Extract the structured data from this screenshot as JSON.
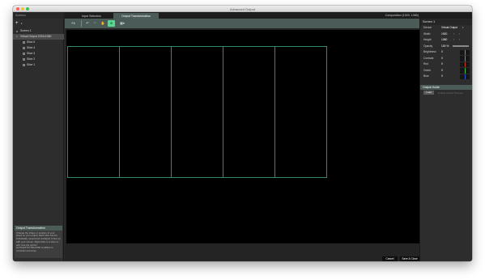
{
  "window": {
    "title": "Advanced Output"
  },
  "tabs": [
    {
      "label": "Input Selection",
      "active": false
    },
    {
      "label": "Output Transformation",
      "active": true
    }
  ],
  "composition_size": "Composition (1920, 1080)",
  "sidebar": {
    "header": "Screens",
    "add_label": "+",
    "items": [
      {
        "label": "Screen 1",
        "level": 0
      },
      {
        "label": "Virtual Output 1920x1080",
        "level": 1
      },
      {
        "label": "Slice 5",
        "level": 2
      },
      {
        "label": "Slice 4",
        "level": 2
      },
      {
        "label": "Slice 3",
        "level": 2
      },
      {
        "label": "Slice 2",
        "level": 2
      },
      {
        "label": "Slice 1",
        "level": 2
      }
    ],
    "help": {
      "title": "Output Transformation",
      "body": "Change the shape or position of your slices on your output. Each slice can be individually moved and reshaped to line up with your screen. Right click on a slice to edit. Use the option/ ALT/SHIFT/CTRL/CMD modifiers to constrain and snap."
    }
  },
  "toolbar": {
    "fit_label": "Fit",
    "undo_icon": "↶",
    "redo_icon": "↷",
    "grab_icon": "✋",
    "transform_icon": "⊕",
    "grid_icon": "▦▾"
  },
  "canvas": {
    "slice_count": 5,
    "background": "#000000",
    "slice_outline_color": "#2f8a6e"
  },
  "footer": {
    "cancel_label": "Cancel",
    "save_label": "Save & Close"
  },
  "properties": {
    "title": "Screen 1",
    "device": {
      "label": "Device",
      "value": "Virtual Output"
    },
    "width": {
      "label": "Width",
      "value": "1920"
    },
    "height": {
      "label": "Height",
      "value": "1080"
    },
    "opacity": {
      "label": "Opacity",
      "value": "100 %",
      "level": 1.0
    },
    "brightness": {
      "label": "Brightness",
      "value": "0"
    },
    "contrast": {
      "label": "Contrast",
      "value": "0"
    },
    "red": {
      "label": "Red",
      "value": "0",
      "color": "#d03a2a"
    },
    "green": {
      "label": "Green",
      "value": "0",
      "color": "#3cc04a"
    },
    "blue": {
      "label": "Blue",
      "value": "0",
      "color": "#2a5ad0"
    },
    "output_guide": {
      "title": "Output Guide",
      "button": "Load",
      "link": "Enable Output Preview"
    }
  },
  "colors": {
    "accent": "#4b5b57",
    "active_tool": "#57d98e"
  }
}
